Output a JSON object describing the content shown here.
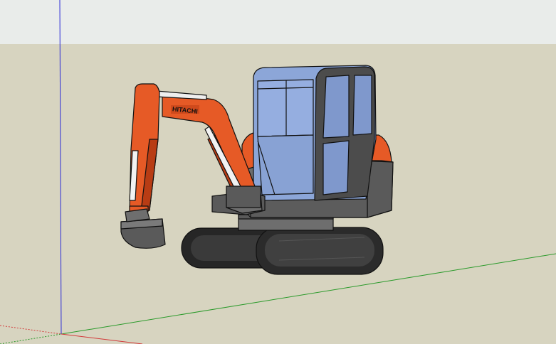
{
  "app": "sketchup-3d-viewport",
  "scene": {
    "model": "mini-excavator",
    "boom_brand_text": "HITACHI"
  },
  "colors": {
    "sky": "#e9ecea",
    "ground": "#d7d4c0",
    "boom_orange": "#e65a26",
    "boom_orange_dark": "#b83c14",
    "glass_blue": "#8ca6d8",
    "glass_blue_dark": "#6b86c0",
    "body_gray": "#6e6e6e",
    "body_gray_dark": "#4a4a4a",
    "track_black": "#262626",
    "outline": "#111111",
    "axis_blue": "#2b2bd6",
    "axis_green": "#2a9a2a",
    "axis_red": "#d23a3a"
  },
  "icons": {
    "axis-origin": "axis-origin-icon"
  }
}
